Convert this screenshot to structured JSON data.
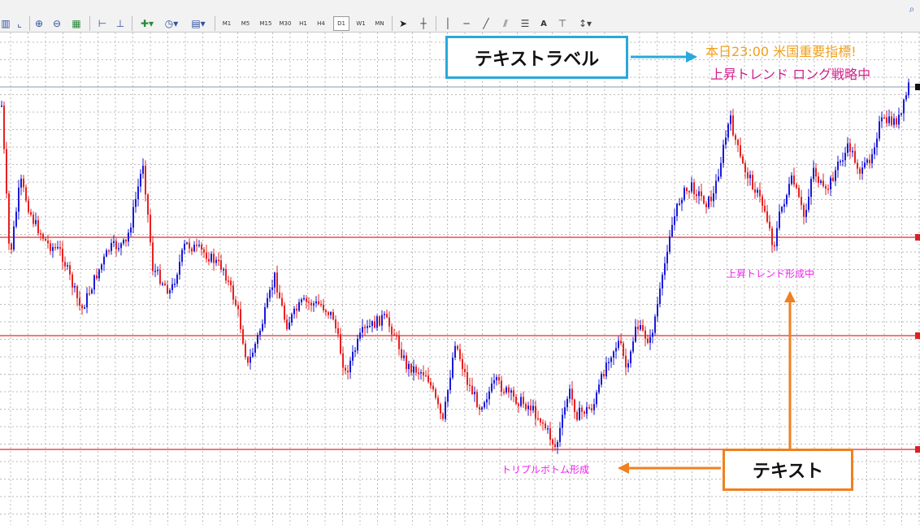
{
  "toolbar": {
    "timeframes": [
      "M1",
      "M5",
      "M15",
      "M30",
      "H1",
      "H4",
      "D1",
      "W1",
      "MN"
    ],
    "active_timeframe": "D1",
    "text_tool_label": "A"
  },
  "callouts": {
    "text_label": "テキストラベル",
    "text": "テキスト"
  },
  "chart_labels": {
    "line1": "本日23:00 米国重要指標!",
    "line2": "上昇トレンド ロング戦略中"
  },
  "annotations": {
    "uptrend": "上昇トレンド形成中",
    "triple_bottom": "トリプルボトム形成"
  },
  "colors": {
    "bull_candle": "#1a1ad8",
    "bear_candle": "#e82020",
    "horizontal_line": "#e85050",
    "grid": "#bbbbbb",
    "label_box_border": "#29a8dc",
    "text_box_border": "#f08020",
    "annotation_text": "#ee22ee"
  }
}
